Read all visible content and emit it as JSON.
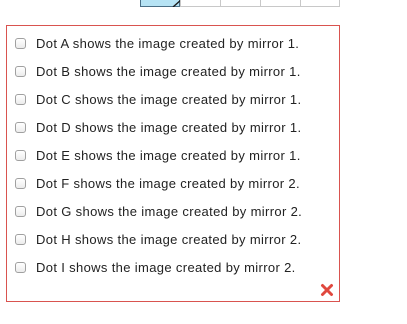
{
  "options": [
    {
      "label": "Dot A shows the image created by mirror 1."
    },
    {
      "label": "Dot B shows the image created by mirror 1."
    },
    {
      "label": "Dot C shows the image created by mirror 1."
    },
    {
      "label": "Dot D shows the image created by mirror 1."
    },
    {
      "label": "Dot E shows the image created by mirror 1."
    },
    {
      "label": "Dot F shows the image created by mirror 2."
    },
    {
      "label": "Dot G shows the image created by mirror 2."
    },
    {
      "label": "Dot H shows the image created by mirror 2."
    },
    {
      "label": "Dot I shows the image created by mirror 2."
    }
  ],
  "feedback": {
    "icon": "incorrect-x-icon",
    "color": "#e0483e"
  },
  "colors": {
    "panel_border": "#d9534f",
    "highlight_cell": "#b6e3f4"
  }
}
